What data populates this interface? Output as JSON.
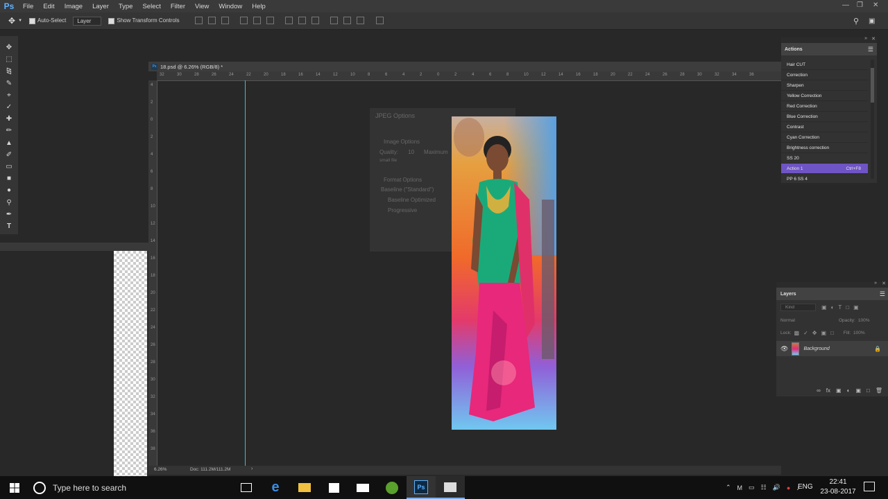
{
  "app": {
    "logo": "Ps"
  },
  "menu": [
    "File",
    "Edit",
    "Image",
    "Layer",
    "Type",
    "Select",
    "Filter",
    "View",
    "Window",
    "Help"
  ],
  "options": {
    "auto_select": "Auto-Select",
    "layer_select": "Layer",
    "transform": "Show Transform Controls"
  },
  "document": {
    "tab_title": "18.psd @ 6.26% (RGB/8) *",
    "zoom": "6.26%",
    "doc_size": "Doc: 111.2M/111.2M",
    "ruler_h": [
      "32",
      "30",
      "28",
      "26",
      "24",
      "22",
      "20",
      "18",
      "16",
      "14",
      "12",
      "10",
      "8",
      "6",
      "4",
      "2",
      "0",
      "2",
      "4",
      "6",
      "8",
      "10",
      "12",
      "14",
      "16",
      "18",
      "20",
      "22",
      "24",
      "26",
      "28",
      "30",
      "32",
      "34",
      "36"
    ],
    "ruler_v": [
      "4",
      "2",
      "0",
      "2",
      "4",
      "6",
      "8",
      "10",
      "12",
      "14",
      "16",
      "18",
      "20",
      "22",
      "24",
      "26",
      "28",
      "30",
      "32",
      "34",
      "36",
      "38"
    ]
  },
  "ghost_dialog": {
    "title": "JPEG Options",
    "image_options": "Image Options",
    "quality": "Quality:",
    "quality_val": "10",
    "max": "Maximum",
    "small": "small file",
    "format": "Format Options",
    "baseline": "Baseline (\"Standard\")",
    "baseline_opt": "Baseline Optimized",
    "progressive": "Progressive"
  },
  "actions": {
    "title": "Actions",
    "items": [
      {
        "label": "Hair CUT",
        "key": ""
      },
      {
        "label": "Correction",
        "key": ""
      },
      {
        "label": "Sharpen",
        "key": ""
      },
      {
        "label": "Yellow Correction",
        "key": ""
      },
      {
        "label": "Red Correction",
        "key": ""
      },
      {
        "label": "Blue Correction",
        "key": ""
      },
      {
        "label": "Contrast",
        "key": ""
      },
      {
        "label": "Cyan Correction",
        "key": ""
      },
      {
        "label": "Brightness correction",
        "key": ""
      },
      {
        "label": "SS 20",
        "key": ""
      },
      {
        "label": "Action 1",
        "key": "Ctrl+F8"
      },
      {
        "label": "PP 6 SS 4",
        "key": ""
      }
    ]
  },
  "layers": {
    "title": "Layers",
    "search_placeholder": "Kind",
    "blend": "Normal",
    "opacity_label": "Opacity:",
    "opacity": "100%",
    "lock_label": "Lock:",
    "fill_label": "Fill:",
    "fill": "100%",
    "layer_name": "Background"
  },
  "taskbar": {
    "search_placeholder": "Type here to search",
    "lang": "ENG",
    "time": "22:41",
    "date": "23-08-2017"
  },
  "colors": {
    "accent_selected": "#6e54c4",
    "guide": "#35c0d8",
    "ps_blue": "#5fb2ff"
  }
}
